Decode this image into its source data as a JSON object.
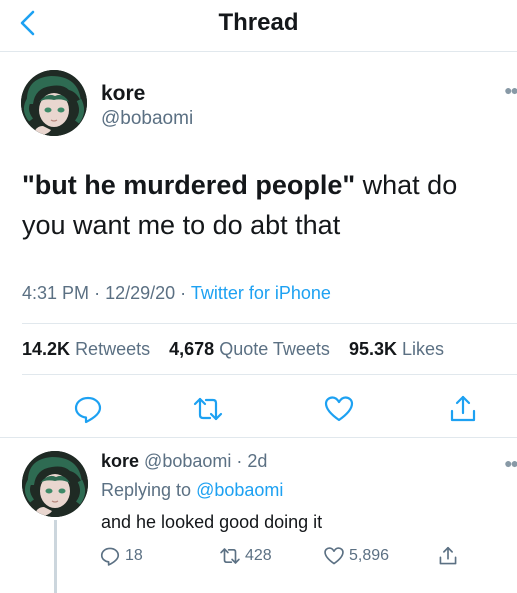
{
  "header": {
    "title": "Thread"
  },
  "tweet": {
    "name": "kore",
    "handle": "@bobaomi",
    "text_quote": "\"but he murdered people\"",
    "text_rest": " what do you want me to do abt that",
    "time": "4:31 PM",
    "date": "12/29/20",
    "source": "Twitter for iPhone",
    "stats": {
      "retweets_count": "14.2K",
      "retweets_label": "Retweets",
      "quotes_count": "4,678",
      "quotes_label": "Quote Tweets",
      "likes_count": "95.3K",
      "likes_label": "Likes"
    }
  },
  "reply": {
    "name": "kore",
    "handle": "@bobaomi",
    "time": "2d",
    "replying_label": "Replying to",
    "replying_to": "@bobaomi",
    "text": "and he looked good doing it",
    "replies": "18",
    "retweets": "428",
    "likes": "5,896"
  },
  "colors": {
    "accent": "#1da1f2",
    "secondary": "#5b7083",
    "divider": "#e1e8ed"
  },
  "icons": [
    "back-chevron-icon",
    "reply-icon",
    "retweet-icon",
    "like-icon",
    "share-icon",
    "more-icon"
  ]
}
